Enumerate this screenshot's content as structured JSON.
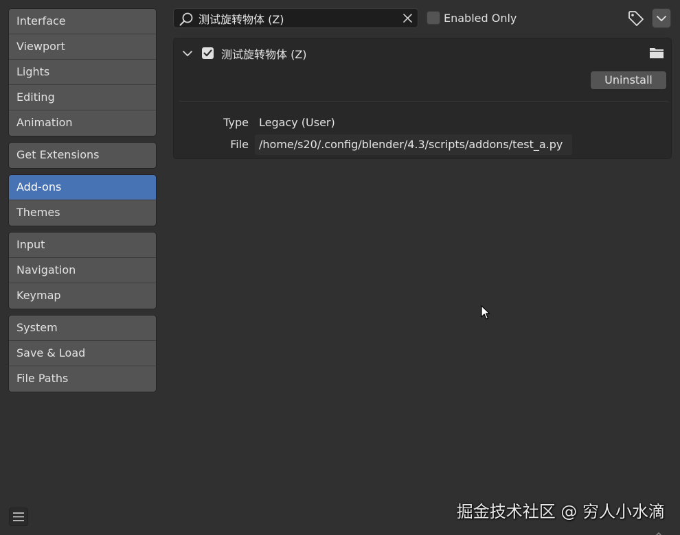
{
  "sidebar": {
    "groups": [
      {
        "items": [
          {
            "label": "Interface"
          },
          {
            "label": "Viewport"
          },
          {
            "label": "Lights"
          },
          {
            "label": "Editing"
          },
          {
            "label": "Animation"
          }
        ]
      },
      {
        "items": [
          {
            "label": "Get Extensions"
          }
        ]
      },
      {
        "items": [
          {
            "label": "Add-ons",
            "active": true
          },
          {
            "label": "Themes"
          }
        ]
      },
      {
        "items": [
          {
            "label": "Input"
          },
          {
            "label": "Navigation"
          },
          {
            "label": "Keymap"
          }
        ]
      },
      {
        "items": [
          {
            "label": "System"
          },
          {
            "label": "Save & Load"
          },
          {
            "label": "File Paths"
          }
        ]
      }
    ]
  },
  "header": {
    "search": {
      "value": "测试旋转物体 (Z)",
      "icon": "search-icon",
      "clear_icon": "close-icon"
    },
    "enabled_only": {
      "label": "Enabled Only",
      "checked": false
    },
    "tag_icon": "tag-icon",
    "menu_icon": "chevron-down-icon"
  },
  "addon": {
    "name": "测试旋转物体 (Z)",
    "enabled": true,
    "expanded": true,
    "uninstall_label": "Uninstall",
    "type_key": "Type",
    "type_value": "Legacy (User)",
    "file_key": "File",
    "file_value": "/home/s20/.config/blender/4.3/scripts/addons/test_a.py"
  },
  "footer": {
    "menu_icon": "hamburger-icon"
  },
  "watermark": "掘金技术社区 @ 穷人小水滴",
  "colors": {
    "background": "#303030",
    "active_item": "#4772b3",
    "button": "#545454",
    "panel": "#282828"
  }
}
